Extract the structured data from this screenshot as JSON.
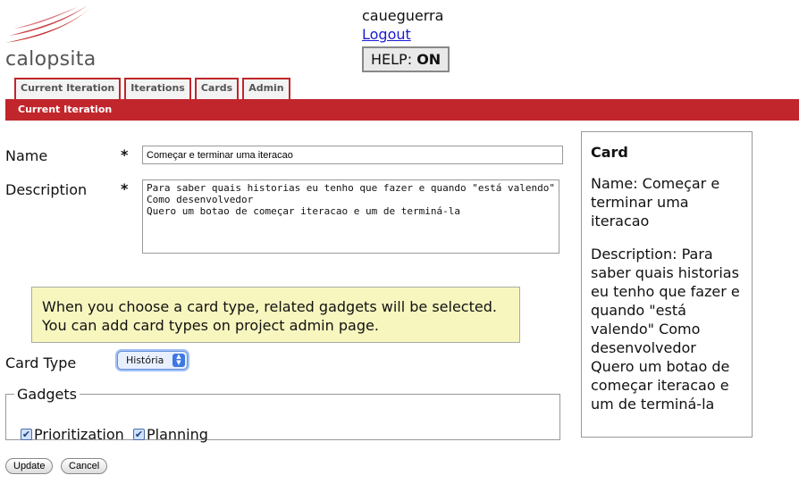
{
  "app": {
    "name": "calopsita"
  },
  "user": {
    "name": "caueguerra",
    "logout_label": "Logout",
    "help_label": "HELP:",
    "help_state": "ON"
  },
  "tabs": [
    {
      "label": "Current Iteration"
    },
    {
      "label": "Iterations"
    },
    {
      "label": "Cards"
    },
    {
      "label": "Admin"
    }
  ],
  "section_title": "Current Iteration",
  "form": {
    "name_label": "Name",
    "name_required": "*",
    "name_value": "Começar e terminar uma iteracao",
    "description_label": "Description",
    "description_required": "*",
    "description_value": "Para saber quais historias eu tenho que fazer e quando \"está valendo\"\nComo desenvolvedor\nQuero um botao de começar iteracao e um de terminá-la",
    "info_text": "When you choose a card type, related gadgets will be selected. You can add card types on project admin page.",
    "card_type_label": "Card Type",
    "card_type_selected": "História",
    "gadgets_legend": "Gadgets",
    "gadgets": [
      {
        "label": "Prioritization",
        "checked": true
      },
      {
        "label": "Planning",
        "checked": true
      }
    ],
    "update_label": "Update",
    "cancel_label": "Cancel"
  },
  "card_preview": {
    "title": "Card",
    "name_text": "Name: Começar e terminar uma iteracao",
    "description_text": "Description: Para saber quais historias eu tenho que fazer e quando \"está valendo\" Como desenvolvedor Quero um botao de começar iteracao e um de terminá-la"
  },
  "colors": {
    "brand_red": "#c1262c",
    "info_bg": "#f7f6bf",
    "link": "#1a1ad6"
  }
}
